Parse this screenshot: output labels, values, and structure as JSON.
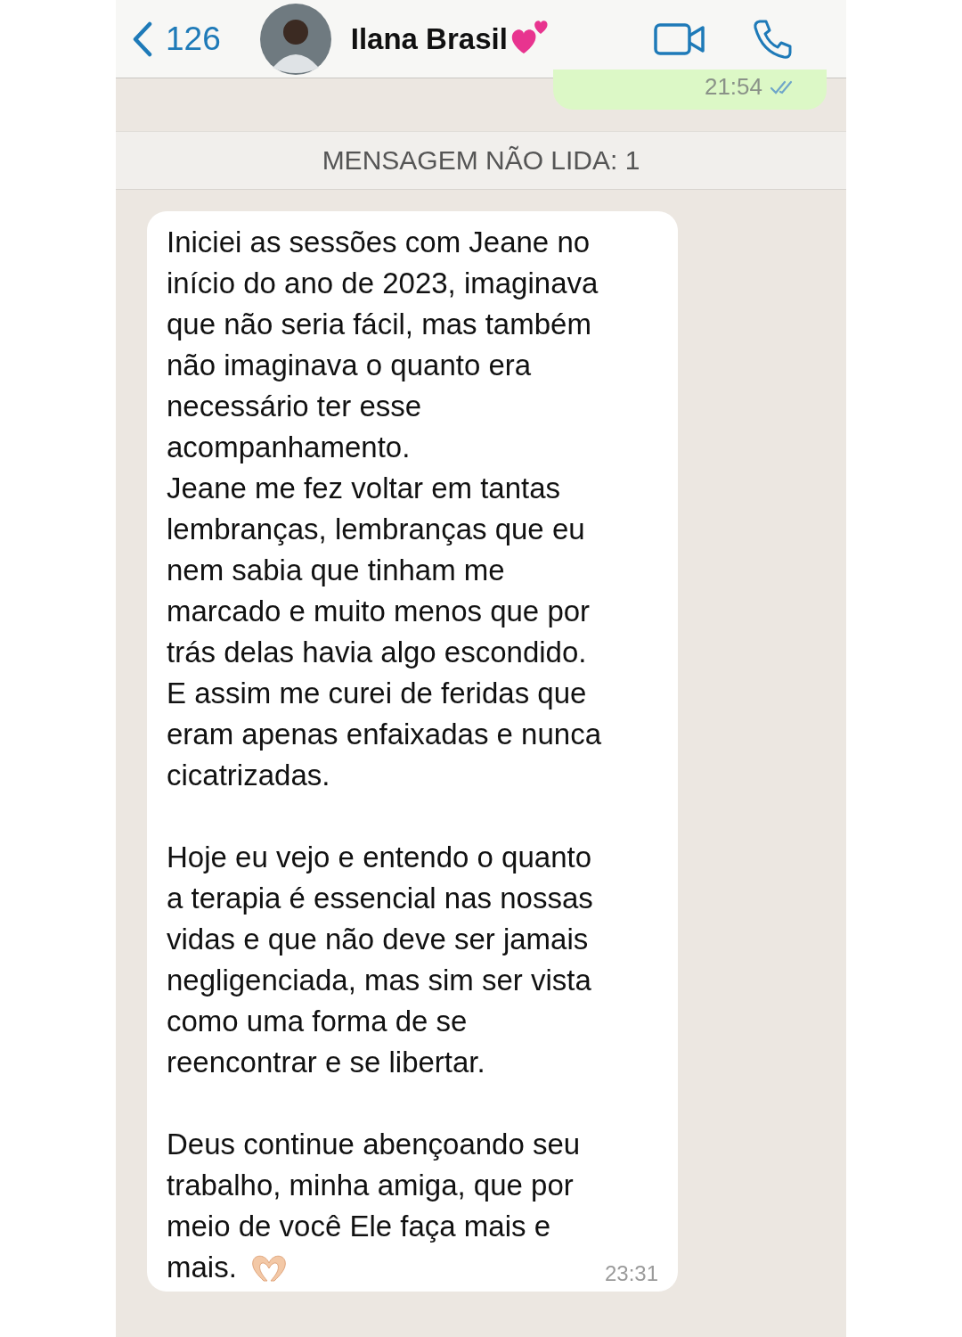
{
  "header": {
    "back_count": "126",
    "contact_name": "Ilana Brasil"
  },
  "sent_message": {
    "time": "21:54",
    "read": true
  },
  "unread_banner": "MENSAGEM NÃO LIDA: 1",
  "received_message": {
    "text": "Iniciei as sessões com Jeane no\ninício do ano de 2023, imaginava\nque não seria fácil, mas também\nnão imaginava o quanto era\nnecessário ter esse\nacompanhamento.\nJeane me fez voltar em tantas\nlembranças, lembranças que eu\nnem sabia que tinham me\nmarcado e muito menos que por\ntrás delas havia algo escondido.\nE assim me curei de feridas que\neram apenas enfaixadas e nunca\ncicatrizadas.\n\nHoje eu vejo e entendo o quanto\na terapia é essencial nas nossas\nvidas e que não deve ser jamais\nnegligenciada, mas sim ser vista\ncomo uma forma de se\nreencontrar e se libertar.\n\nDeus continue abençoando seu\ntrabalho, minha amiga, que por\nmeio de você Ele faça mais e\nmais.",
    "time": "23:31"
  }
}
